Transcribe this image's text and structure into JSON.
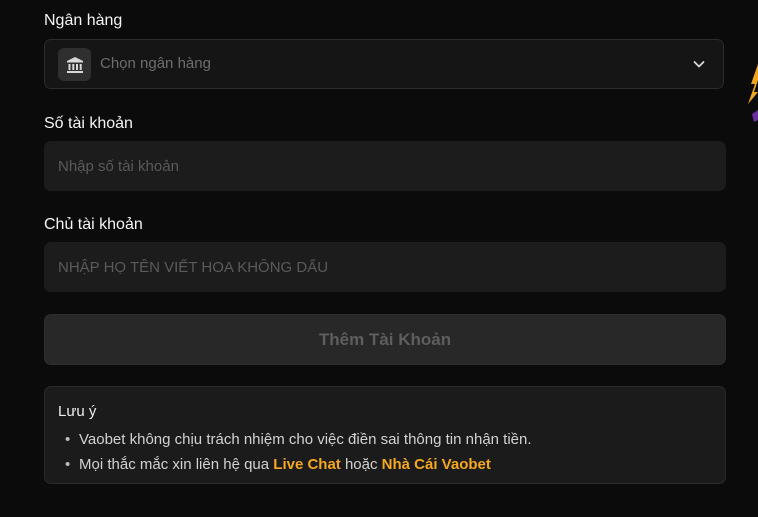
{
  "form": {
    "bank": {
      "label": "Ngân hàng",
      "placeholder": "Chọn ngân hàng",
      "icon": "bank-icon",
      "dropdown_icon": "chevron-down-icon"
    },
    "account_number": {
      "label": "Số tài khoản",
      "placeholder": "Nhập số tài khoản",
      "value": ""
    },
    "account_holder": {
      "label": "Chủ tài khoản",
      "placeholder": "NHẬP HỌ TÊN VIẾT HOA KHÔNG DẤU",
      "value": ""
    },
    "submit_label": "Thêm Tài Khoản"
  },
  "note": {
    "title": "Lưu ý",
    "items": [
      {
        "text": "Vaobet không chịu trách nhiệm cho việc điền sai thông tin nhận tiền."
      },
      {
        "prefix": "Mọi thắc mắc xin liên hệ qua ",
        "link1": "Live Chat",
        "middle": " hoặc ",
        "link2": "Nhà Cái Vaobet"
      }
    ]
  },
  "colors": {
    "background": "#0b0b0b",
    "input_background": "#1c1c1c",
    "accent": "#f5a623",
    "disabled_text": "#5e5e5e"
  }
}
